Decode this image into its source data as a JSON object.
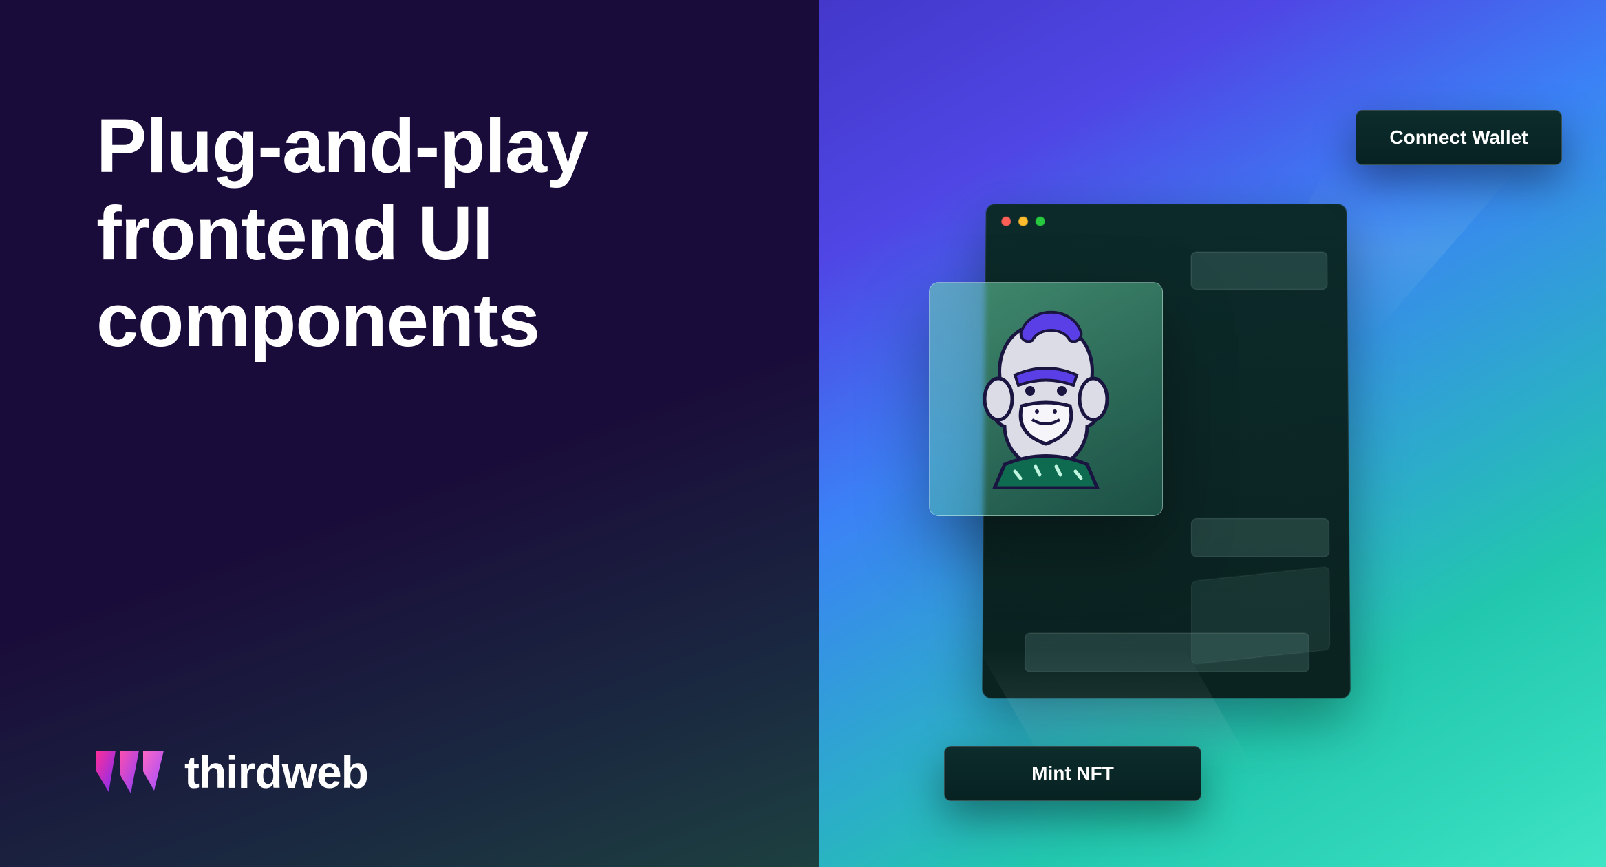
{
  "headline": "Plug-and-play frontend UI components",
  "brand": {
    "name": "thirdweb"
  },
  "buttons": {
    "connect_wallet": "Connect Wallet",
    "mint_nft": "Mint NFT"
  },
  "icons": {
    "nft": "ape-nft-icon",
    "logo": "thirdweb-logo-icon"
  }
}
